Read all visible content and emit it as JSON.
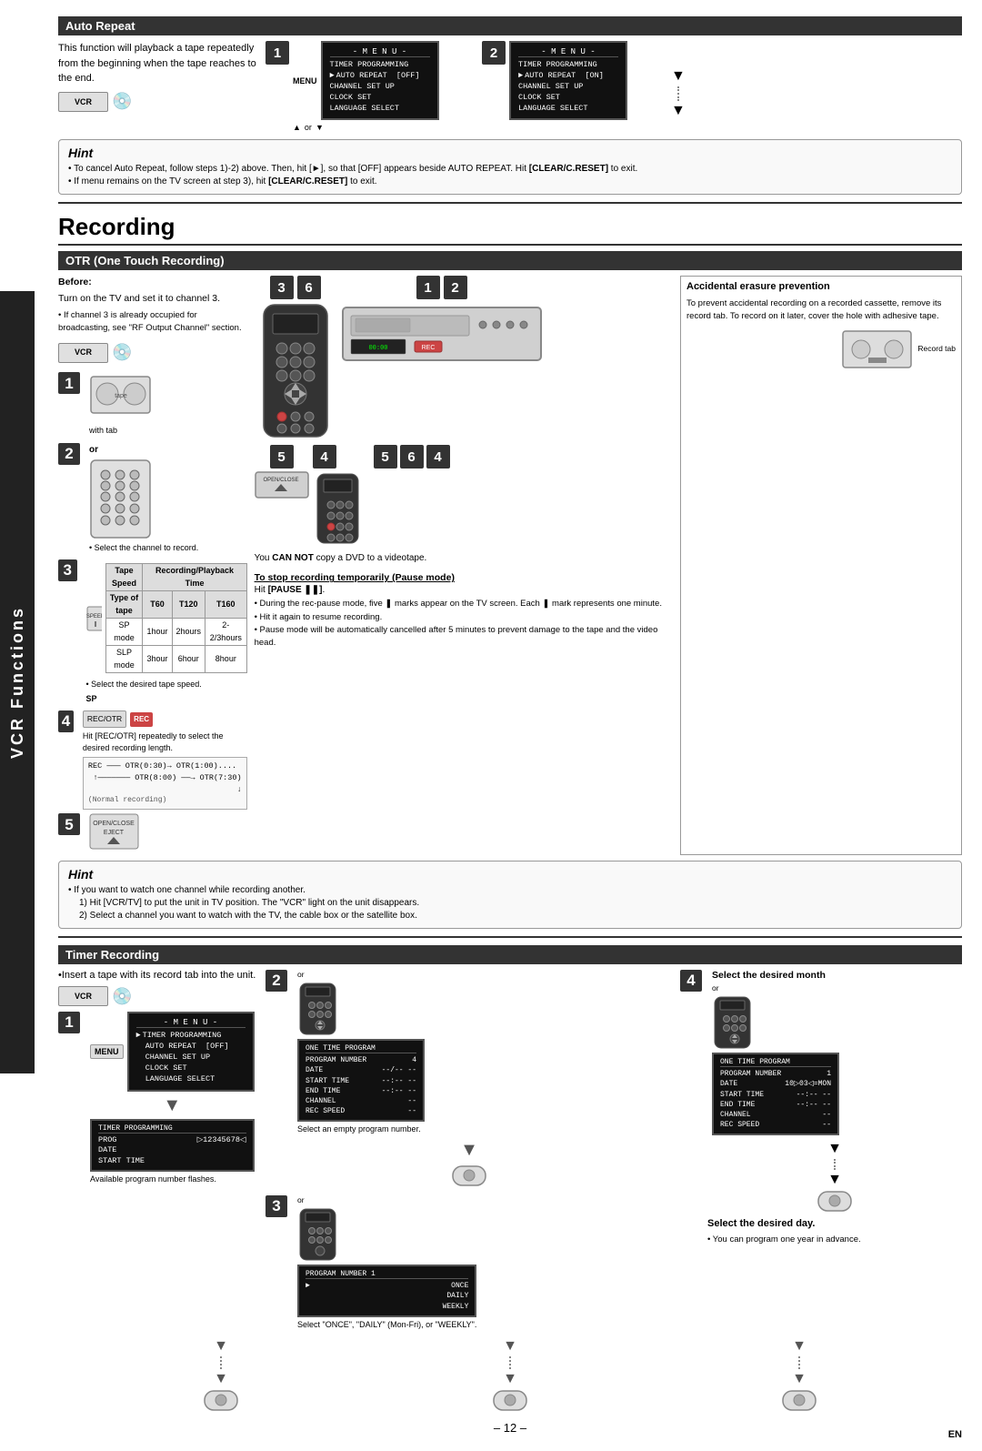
{
  "sidebar": {
    "label": "VCR Functions"
  },
  "auto_repeat": {
    "header": "Auto Repeat",
    "text": "This function will playback a tape repeatedly from the beginning when the tape reaches to the end.",
    "step1_label": "1",
    "step2_label": "2",
    "menu_title": "- M E N U -",
    "menu_items": [
      "TIMER PROGRAMMING",
      "► AUTO REPEAT  [OFF]",
      "CHANNEL SET UP",
      "CLOCK SET",
      "LANGUAGE SELECT"
    ],
    "menu2_items": [
      "TIMER PROGRAMMING",
      "► AUTO REPEAT  [ON]",
      "CHANNEL SET UP",
      "CLOCK SET",
      "LANGUAGE SELECT"
    ]
  },
  "hint1": {
    "title": "Hint",
    "lines": [
      "• To cancel Auto Repeat, follow steps 1)-2) above. Then, hit [►], so that [OFF] appears beside AUTO REPEAT. Hit [CLEAR/C.RESET] to exit.",
      "• If menu remains on the TV screen at step 3), hit [CLEAR/C.RESET] to exit."
    ]
  },
  "recording": {
    "title": "Recording"
  },
  "otr": {
    "header": "OTR (One Touch Recording)",
    "before_label": "Before:",
    "before_text": "Turn on the TV and set it to channel 3.",
    "before_note": "• If channel 3 is already occupied for broadcasting, see \"RF Output Channel\" section.",
    "step3_label": "3",
    "step6_label": "6",
    "step1_label": "1",
    "step2_label": "2",
    "step5_label": "5",
    "step4_label": "4",
    "step56_label": "5 6",
    "or_label": "or",
    "select_channel": "• Select the channel to record.",
    "tape_speed_header": "Tape Speed",
    "rec_pb_time": "Recording/Playback Time",
    "type_of_tape": "Type of tape",
    "t60": "T60",
    "t120": "T120",
    "t160": "T160",
    "sp_mode": "SP mode",
    "slp_mode": "SLP mode",
    "sp_times": [
      "1hour",
      "2hours",
      "2-2/3hours"
    ],
    "slp_times": [
      "3hour",
      "6hour",
      "8hour"
    ],
    "select_speed": "• Select the desired tape speed.",
    "sp_label": "SP",
    "step4_text": "Hit [REC/OTR] repeatedly to select the desired recording length.",
    "rec_normal": "REC  (Normal recording)",
    "rec_otr1": "OTR(0:30)",
    "rec_otr2": "OTR(1:00)....",
    "rec_otr3": "OTR(8:00)",
    "rec_otr4": "OTR(7:30)",
    "cannot_copy": "You CAN NOT copy a DVD to a videotape.",
    "accidental_header": "Accidental erasure prevention",
    "accidental_text": "To prevent accidental recording on a recorded cassette, remove its record tab. To record on it later, cover the hole with adhesive tape.",
    "record_tab": "Record tab",
    "pause_header": "To stop recording temporarily (Pause mode)",
    "pause_hit": "Hit [PAUSE ❚❚].",
    "pause_bullets": [
      "• During the rec-pause mode, five ❚ marks appear on the TV screen. Each ❚ mark represents one minute.",
      "• Hit it again to resume recording.",
      "• Pause mode will be automatically cancelled after 5 minutes to prevent damage to the tape and the video head."
    ],
    "step5_open": "OPEN/CLOSE EJECT"
  },
  "hint2": {
    "title": "Hint",
    "lines": [
      "• If you want to watch one channel while recording another.",
      "  1) Hit [VCR/TV] to put the unit in TV position. The \"VCR\" light on the unit disappears.",
      "  2) Select a channel you want to watch with the TV, the cable box or the satellite box."
    ]
  },
  "timer": {
    "header": "Timer Recording",
    "intro": "•Insert a tape with its record tab into the unit.",
    "step1_label": "1",
    "step2_label": "2",
    "step3_label": "3",
    "step4_label": "4",
    "menu_label": "MENU",
    "menu_title": "- M E N U -",
    "menu_items": [
      "► TIMER PROGRAMMING",
      "AUTO REPEAT  [OFF]",
      "CHANNEL SET UP",
      "CLOCK SET",
      "LANGUAGE SELECT"
    ],
    "prog_title": "TIMER PROGRAMMING",
    "prog_rows": [
      [
        "PROG",
        "▷12345678◁"
      ],
      [
        "DATE",
        ""
      ],
      [
        "START TIME",
        ""
      ]
    ],
    "avail_text": "Available program number flashes.",
    "prog_num_title": "ONE TIME PROGRAM",
    "prog_num_rows": [
      [
        "PROGRAM NUMBER",
        "4"
      ],
      [
        "DATE",
        "--/--  --"
      ],
      [
        "START TIME",
        "--:-- --"
      ],
      [
        "END TIME",
        "--:-- --"
      ],
      [
        "CHANNEL",
        "--"
      ],
      [
        "REC SPEED",
        "--"
      ]
    ],
    "select_empty": "Select an empty program number.",
    "step3_screen_title": "PROGRAM NUMBER 1",
    "step3_options": [
      "► ONCE",
      "DAILY",
      "WEEKLY"
    ],
    "step3_select": "Select \"ONCE\", \"DAILY\" (Mon-Fri), or \"WEEKLY\".",
    "step4_header": "Select the desired month",
    "step4_screen_title": "ONE TIME PROGRAM",
    "step4_prog_rows": [
      [
        "PROGRAM NUMBER",
        "1"
      ],
      [
        "DATE",
        "1 0▷0 3◁=MON"
      ],
      [
        "START TIME",
        "--:-- --"
      ],
      [
        "END TIME",
        "--:-- --"
      ],
      [
        "CHANNEL",
        "--"
      ],
      [
        "REC SPEED",
        "--"
      ]
    ],
    "select_day": "Select the desired day.",
    "one_year": "• You can program one year in advance.",
    "prog_screen_label": "PROGRAM  NUMBER _ DATE START TIME END TIME CHANNEL SPEED Select empty program number",
    "table_headers": [
      "PROGRAM NUMBER",
      "DATE",
      "START TIME",
      "END TIME",
      "CHANNEL",
      "SPEED"
    ]
  },
  "page_number": "– 12 –",
  "en_label": "EN"
}
